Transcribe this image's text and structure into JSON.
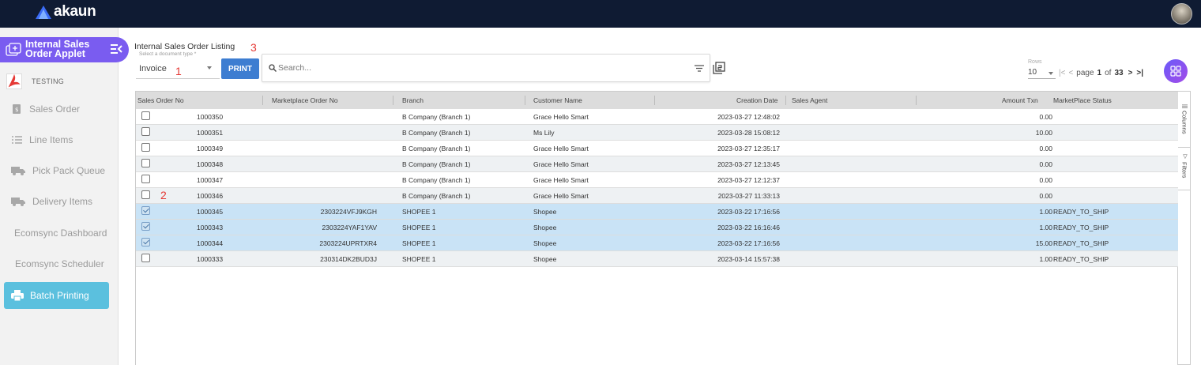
{
  "app": {
    "logo_text": "akaun"
  },
  "sidebar": {
    "applet_title": "Internal Sales Order Applet",
    "testing_label": "TESTING",
    "items": [
      {
        "label": "Sales Order"
      },
      {
        "label": "Line Items"
      },
      {
        "label": "Pick Pack Queue"
      },
      {
        "label": "Delivery Items"
      },
      {
        "label": "Ecomsync Dashboard"
      },
      {
        "label": "Ecomsync Scheduler"
      },
      {
        "label": "Batch Printing"
      }
    ]
  },
  "toolbar": {
    "listing_title": "Internal Sales Order Listing",
    "doctype_label": "Select a document type *",
    "doctype_value": "Invoice",
    "print_label": "PRINT",
    "search_placeholder": "Search...",
    "rows_label": "Rows",
    "rows_value": "10",
    "page_word": "page",
    "page_current": "1",
    "page_of": "of",
    "page_total": "33"
  },
  "annotations": {
    "a1": "1",
    "a2": "2",
    "a3": "3"
  },
  "table": {
    "columns": [
      "Sales Order No",
      "Marketplace Order No",
      "Branch",
      "Customer Name",
      "Creation Date",
      "Sales Agent",
      "Amount Txn",
      "MarketPlace Status"
    ],
    "rows": [
      {
        "so": "1000350",
        "mp": "",
        "branch": "B Company (Branch 1)",
        "customer": "Grace Hello Smart",
        "date": "2023-03-27 12:48:02",
        "amount": "0.00",
        "status": "",
        "checked": false
      },
      {
        "so": "1000351",
        "mp": "",
        "branch": "B Company (Branch 1)",
        "customer": "Ms Lily",
        "date": "2023-03-28 15:08:12",
        "amount": "10.00",
        "status": "",
        "checked": false
      },
      {
        "so": "1000349",
        "mp": "",
        "branch": "B Company (Branch 1)",
        "customer": "Grace Hello Smart",
        "date": "2023-03-27 12:35:17",
        "amount": "0.00",
        "status": "",
        "checked": false
      },
      {
        "so": "1000348",
        "mp": "",
        "branch": "B Company (Branch 1)",
        "customer": "Grace Hello Smart",
        "date": "2023-03-27 12:13:45",
        "amount": "0.00",
        "status": "",
        "checked": false
      },
      {
        "so": "1000347",
        "mp": "",
        "branch": "B Company (Branch 1)",
        "customer": "Grace Hello Smart",
        "date": "2023-03-27 12:12:37",
        "amount": "0.00",
        "status": "",
        "checked": false
      },
      {
        "so": "1000346",
        "mp": "",
        "branch": "B Company (Branch 1)",
        "customer": "Grace Hello Smart",
        "date": "2023-03-27 11:33:13",
        "amount": "0.00",
        "status": "",
        "checked": false
      },
      {
        "so": "1000345",
        "mp": "2303224VFJ9KGH",
        "branch": "SHOPEE 1",
        "customer": "Shopee",
        "date": "2023-03-22 17:16:56",
        "amount": "1.00",
        "status": "READY_TO_SHIP",
        "checked": true
      },
      {
        "so": "1000343",
        "mp": "2303224YAF1YAV",
        "branch": "SHOPEE 1",
        "customer": "Shopee",
        "date": "2023-03-22 16:16:46",
        "amount": "1.00",
        "status": "READY_TO_SHIP",
        "checked": true
      },
      {
        "so": "1000344",
        "mp": "2303224UPRTXR4",
        "branch": "SHOPEE 1",
        "customer": "Shopee",
        "date": "2023-03-22 17:16:56",
        "amount": "15.00",
        "status": "READY_TO_SHIP",
        "checked": true
      },
      {
        "so": "1000333",
        "mp": "230314DK2BUD3J",
        "branch": "SHOPEE 1",
        "customer": "Shopee",
        "date": "2023-03-14 15:57:38",
        "amount": "1.00",
        "status": "READY_TO_SHIP",
        "checked": false
      }
    ]
  },
  "side_panel": {
    "columns_label": "Columns",
    "filters_label": "Filters"
  },
  "colors": {
    "topbar": "#0f1b33",
    "applet": "#7a5cf0",
    "print": "#3d7dd1",
    "batch": "#5bc0de",
    "selected_row": "#c9e3f6",
    "annotation": "#e53935"
  }
}
